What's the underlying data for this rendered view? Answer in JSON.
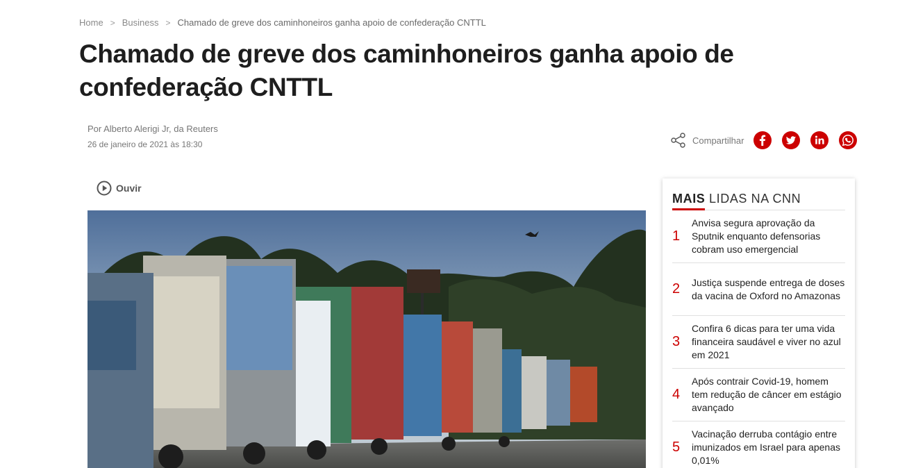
{
  "breadcrumb": {
    "home": "Home",
    "section": "Business",
    "current": "Chamado de greve dos caminhoneiros ganha apoio de confederação CNTTL",
    "separator": ">"
  },
  "article": {
    "headline": "Chamado de greve dos caminhoneiros ganha apoio de confederação CNTTL",
    "author": "Por Alberto Alerigi Jr, da Reuters",
    "date": "26 de janeiro de 2021 às 18:30",
    "listen_label": "Ouvir",
    "image_alt": "Caminhões enfileirados em uma rodovia"
  },
  "share": {
    "label": "Compartilhar",
    "networks": [
      {
        "name": "facebook",
        "icon": "facebook-icon"
      },
      {
        "name": "twitter",
        "icon": "twitter-icon"
      },
      {
        "name": "linkedin",
        "icon": "linkedin-icon"
      },
      {
        "name": "whatsapp",
        "icon": "whatsapp-icon"
      }
    ]
  },
  "sidebar": {
    "title_strong": "MAIS",
    "title_rest": " LIDAS NA CNN",
    "items": [
      {
        "number": "1",
        "text": "Anvisa segura aprovação da Sputnik enquanto defensorias cobram uso emergencial"
      },
      {
        "number": "2",
        "text": "Justiça suspende entrega de doses da vacina de Oxford no Amazonas"
      },
      {
        "number": "3",
        "text": "Confira 6 dicas para ter uma vida financeira saudável e viver no azul em 2021"
      },
      {
        "number": "4",
        "text": "Após contrair Covid-19, homem tem redução de câncer em estágio avançado"
      },
      {
        "number": "5",
        "text": "Vacinação derruba contágio entre imunizados em Israel para apenas 0,01%"
      }
    ]
  },
  "colors": {
    "accent": "#cc0000",
    "text": "#1e1e1e",
    "muted": "#777777"
  }
}
